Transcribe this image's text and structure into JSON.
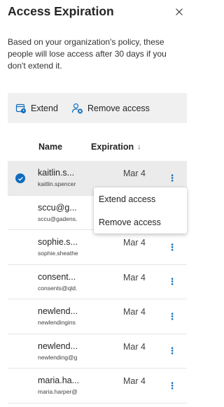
{
  "panel": {
    "title": "Access Expiration",
    "description": "Based on your organization's policy, these people will lose access after 30 days if you don't extend it."
  },
  "toolbar": {
    "extend_label": "Extend",
    "remove_label": "Remove access"
  },
  "columns": {
    "name": "Name",
    "expiration": "Expiration",
    "sort_arrow": "↓"
  },
  "rows": [
    {
      "name": "kaitlin.s...",
      "email": "kaitlin.spencer",
      "expiration": "Mar 4",
      "selected": true
    },
    {
      "name": "sccu@g...",
      "email": "sccu@gadens.",
      "expiration": "",
      "selected": false
    },
    {
      "name": "sophie.s...",
      "email": "sophie.sheathe",
      "expiration": "Mar 4",
      "selected": false
    },
    {
      "name": "consent...",
      "email": "consents@qld.",
      "expiration": "Mar 4",
      "selected": false
    },
    {
      "name": "newlend...",
      "email": "newlendingins",
      "expiration": "Mar 4",
      "selected": false
    },
    {
      "name": "newlend...",
      "email": "newlending@g",
      "expiration": "Mar 4",
      "selected": false
    },
    {
      "name": "maria.ha...",
      "email": "maria.harper@",
      "expiration": "Mar 4",
      "selected": false
    }
  ],
  "context_menu": {
    "extend": "Extend access",
    "remove": "Remove access"
  },
  "colors": {
    "accent": "#0f6cbd",
    "toolbar_bg": "#f0f0f0",
    "selected_row": "#ebebeb"
  }
}
